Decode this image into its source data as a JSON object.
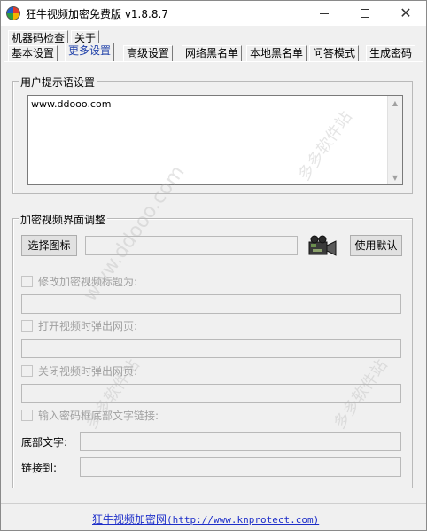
{
  "window": {
    "title": "狂牛视频加密免费版 v1.8.8.7"
  },
  "tabs": {
    "row1": [
      {
        "label": "机器码检查"
      },
      {
        "label": "关于"
      }
    ],
    "row2": [
      {
        "label": "基本设置"
      },
      {
        "label": "更多设置"
      },
      {
        "label": "高级设置"
      },
      {
        "label": "网络黑名单"
      },
      {
        "label": "本地黑名单"
      },
      {
        "label": "问答模式"
      },
      {
        "label": "生成密码"
      }
    ],
    "active": "更多设置"
  },
  "user_prompt": {
    "title": "用户提示语设置",
    "text": "www.ddooo.com"
  },
  "player_ui": {
    "title": "加密视频界面调整",
    "choose_icon_label": "选择图标",
    "icon_path_value": "",
    "default_label": "使用默认",
    "options": [
      {
        "label": "修改加密视频标题为:",
        "checked": false,
        "value": ""
      },
      {
        "label": "打开视频时弹出网页:",
        "checked": false,
        "value": ""
      },
      {
        "label": "关闭视频时弹出网页:",
        "checked": false,
        "value": ""
      },
      {
        "label": "输入密码框底部文字链接:",
        "checked": false
      }
    ],
    "footer_text_label": "底部文字:",
    "footer_text_value": "",
    "link_label": "链接到:",
    "link_value": ""
  },
  "status": {
    "link_name": "狂牛视频加密网",
    "link_url": "(http://www.knprotect.com)"
  },
  "watermarks": [
    "www.ddooo.com",
    "多多软件站"
  ]
}
